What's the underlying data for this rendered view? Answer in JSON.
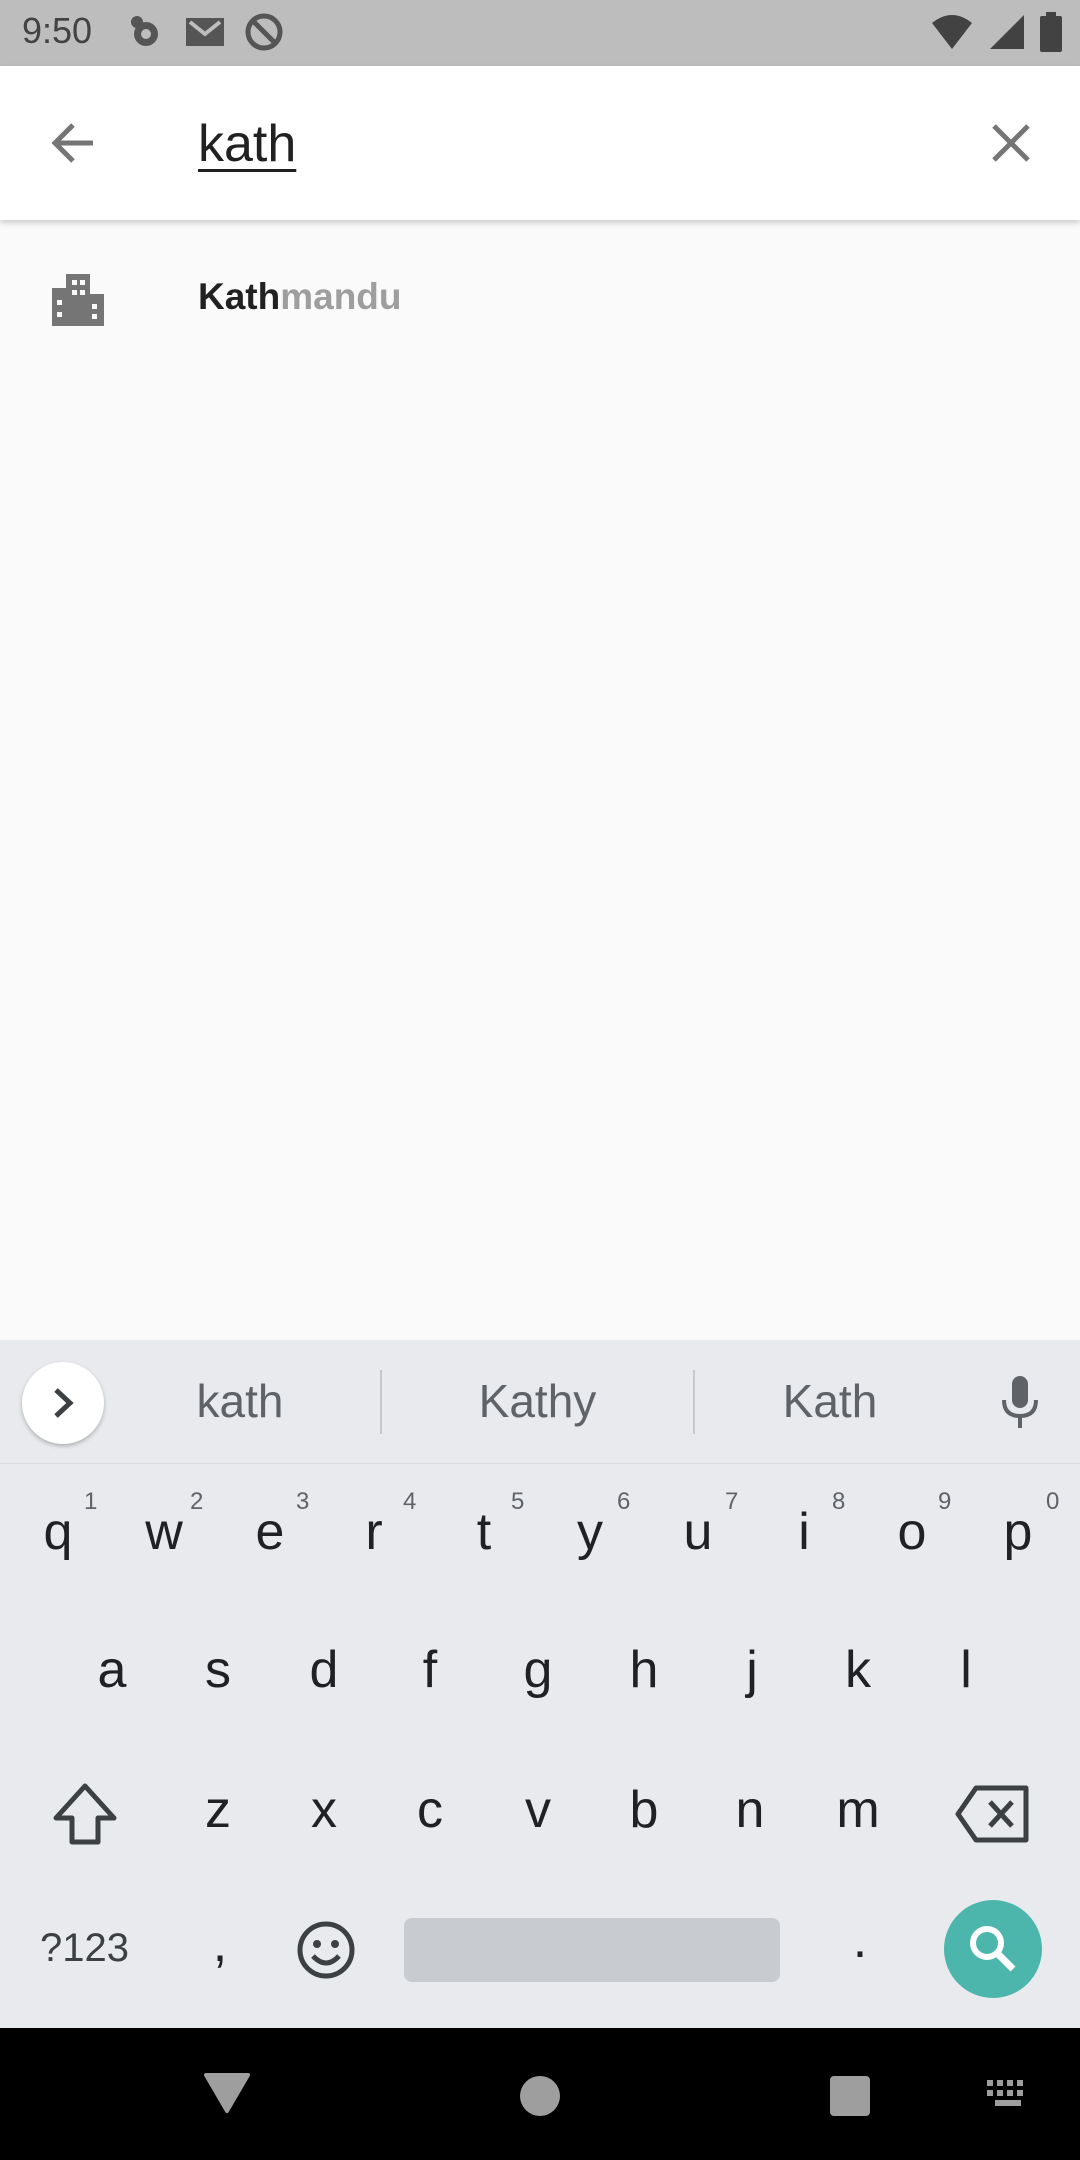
{
  "status_bar": {
    "time": "9:50",
    "left_icons": [
      "settings-notification-icon",
      "gmail-icon",
      "sync-icon"
    ],
    "right_icons": [
      "wifi-icon",
      "signal-icon",
      "battery-icon"
    ]
  },
  "search": {
    "query": "kath",
    "back_icon": "arrow-back-icon",
    "clear_icon": "close-icon"
  },
  "suggestions": [
    {
      "icon": "city-building-icon",
      "match": "Kath",
      "rest": "mandu"
    }
  ],
  "keyboard": {
    "word_suggestions": [
      "kath",
      "Kathy",
      "Kath"
    ],
    "row1": [
      {
        "key": "q",
        "hint": "1"
      },
      {
        "key": "w",
        "hint": "2"
      },
      {
        "key": "e",
        "hint": "3"
      },
      {
        "key": "r",
        "hint": "4"
      },
      {
        "key": "t",
        "hint": "5"
      },
      {
        "key": "y",
        "hint": "6"
      },
      {
        "key": "u",
        "hint": "7"
      },
      {
        "key": "i",
        "hint": "8"
      },
      {
        "key": "o",
        "hint": "9"
      },
      {
        "key": "p",
        "hint": "0"
      }
    ],
    "row2": [
      "a",
      "s",
      "d",
      "f",
      "g",
      "h",
      "j",
      "k",
      "l"
    ],
    "row3": [
      "z",
      "x",
      "c",
      "v",
      "b",
      "n",
      "m"
    ],
    "symbols_label": "?123",
    "comma": ",",
    "period": ".",
    "accent_color": "#4db6ac"
  },
  "nav_bar": {
    "icons": [
      "back-triangle-icon",
      "home-circle-icon",
      "recents-square-icon",
      "keyboard-switch-icon"
    ]
  }
}
